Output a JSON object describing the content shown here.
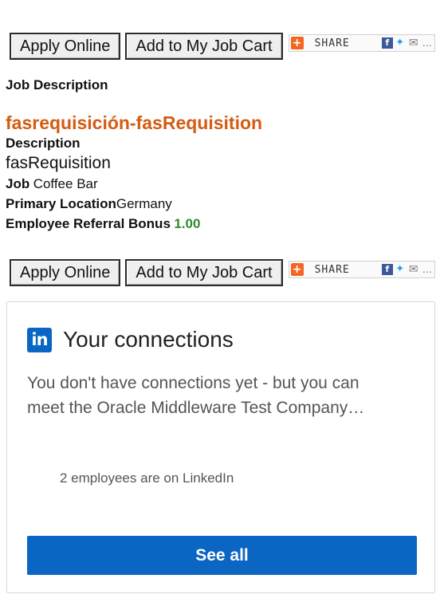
{
  "actions": {
    "apply_label": "Apply Online",
    "cart_label": "Add to My Job Cart",
    "share_label": "SHARE"
  },
  "share_icons": [
    "share-plus-icon",
    "facebook-icon",
    "twitter-icon",
    "email-icon",
    "more-icon"
  ],
  "section_heading": "Job Description",
  "job": {
    "title": "fasrequisición-fasRequisition",
    "description_label": "Description",
    "description_value": "fasRequisition",
    "job_label": "Job",
    "job_value": "Coffee Bar",
    "location_label": "Primary Location",
    "location_value": "Germany",
    "bonus_label": "Employee Referral Bonus",
    "bonus_value": "1.00"
  },
  "linkedin": {
    "logo_text": "in",
    "title": "Your connections",
    "message_line1": "You don't have connections yet - but you can",
    "message_line2": "meet the Oracle Middleware Test Company…",
    "employees_text": "2 employees are on LinkedIn",
    "see_all_label": "See all"
  },
  "colors": {
    "title_orange": "#d35c12",
    "bonus_green": "#2e8b2e",
    "linkedin_blue": "#0a66c2",
    "share_orange": "#f26522"
  }
}
